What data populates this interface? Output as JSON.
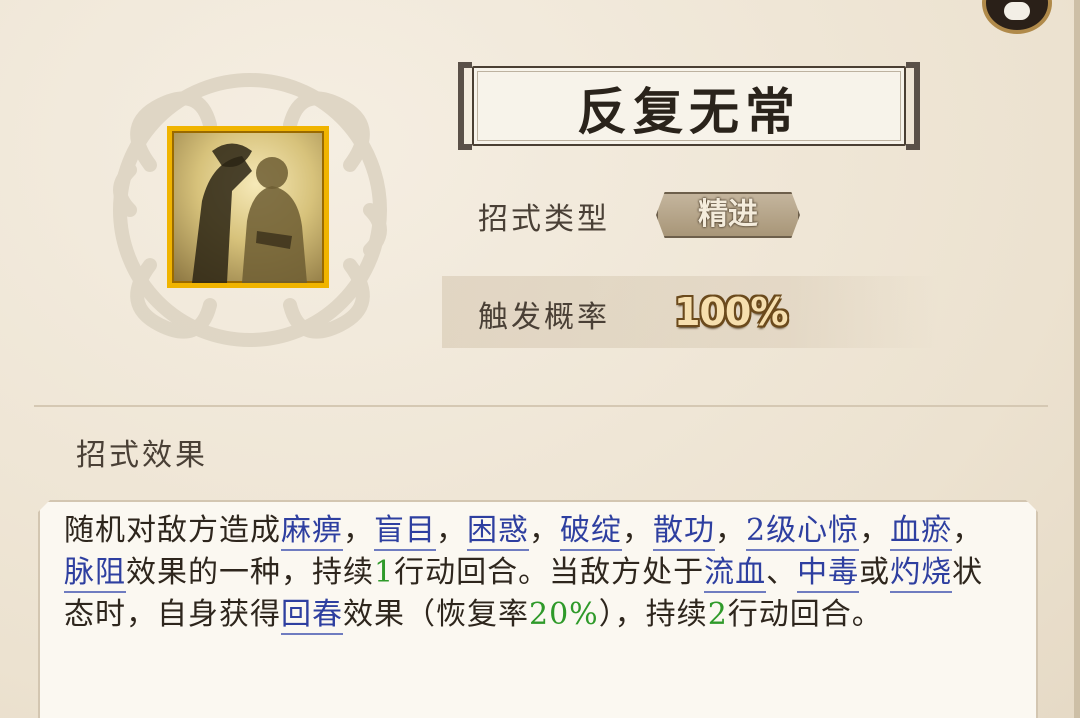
{
  "skill": {
    "name": "反复无常",
    "type_label": "招式类型",
    "type_value": "精进",
    "rate_label": "触发概率",
    "rate_value": "100%",
    "effect_heading": "招式效果",
    "icon": "skill-portrait-icon"
  },
  "description": {
    "segments": [
      {
        "t": "随机对敌方造成"
      },
      {
        "t": "麻痹",
        "kw": true
      },
      {
        "t": "，"
      },
      {
        "t": "盲目",
        "kw": true
      },
      {
        "t": "，"
      },
      {
        "t": "困惑",
        "kw": true
      },
      {
        "t": "，"
      },
      {
        "t": "破绽",
        "kw": true
      },
      {
        "t": "，"
      },
      {
        "t": "散功",
        "kw": true
      },
      {
        "t": "，"
      },
      {
        "t": "2级心惊",
        "kw": true
      },
      {
        "t": "，"
      },
      {
        "t": "血瘀",
        "kw": true
      },
      {
        "t": "，"
      },
      {
        "t": "脉阻",
        "kw": true
      },
      {
        "t": "效果的一种，持续"
      },
      {
        "t": "1",
        "num": true
      },
      {
        "t": "行动回合。当敌方处于"
      },
      {
        "t": "流血",
        "kw": true
      },
      {
        "t": "、"
      },
      {
        "t": "中毒",
        "kw": true
      },
      {
        "t": "或"
      },
      {
        "t": "灼烧",
        "kw": true
      },
      {
        "t": "状态时，自身获得"
      },
      {
        "t": "回春",
        "kw": true
      },
      {
        "t": "效果（恢复率"
      },
      {
        "t": "20%",
        "num": true
      },
      {
        "t": "），持续"
      },
      {
        "t": "2",
        "num": true
      },
      {
        "t": "行动回合。"
      }
    ]
  },
  "colors": {
    "keyword": "#2e3fa0",
    "number": "#2f9a2a",
    "icon_border": "#f0b400"
  }
}
